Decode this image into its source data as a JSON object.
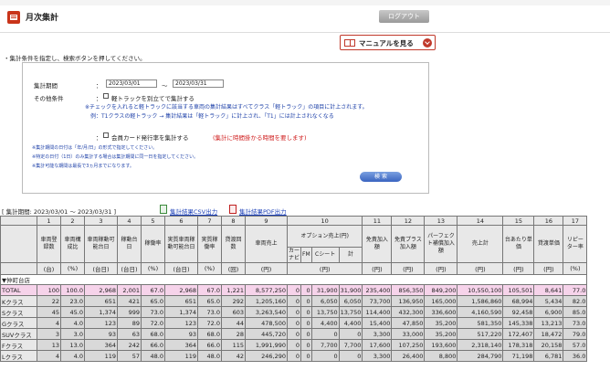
{
  "header": {
    "title": "月次集計",
    "logout_label": "ログアウト"
  },
  "manual_label": "マニュアルを見る",
  "instruction": "・集計条件を指定し、検索ボタンを押してください。",
  "form": {
    "period_label": "集計期間",
    "colon": "：",
    "date_from": "2023/03/01",
    "tilde": "〜",
    "date_to": "2023/03/31",
    "other_label": "その他条件",
    "light_truck_label": "軽トラックを別立てで集計する",
    "light_truck_note1": "※チェックを入れると軽トラックに該当する車両の集計結果はすべてクラス「軽トラック」の項目に計上されます。",
    "light_truck_note2": "例：T1クラスの軽トラック → 集計結果は「軽トラック」に計上され、「T1」には計上されなくなる",
    "card_label": "会員カード発行率を集計する",
    "card_warning": "(集計に時間掛かる時間を要します)",
    "note_a": "※集計期間の日付は「年/月/日」の形式で指定してください。",
    "note_b": "※特定の日付（1日）のみ集計する場合は集計期間に同一日を指定してください。",
    "note_c": "※集計可能な期間は最長で3ヵ月までになります。",
    "search_label": "検 索"
  },
  "result": {
    "period_text": "[ 集計期間: 2023/03/01 〜 2023/03/31 ]",
    "csv_label": "集計結果CSV出力",
    "pdf_label": "集計結果PDF出力"
  },
  "table": {
    "col_numbers": [
      "1",
      "2",
      "3",
      "4",
      "5",
      "6",
      "7",
      "8",
      "9",
      "10",
      "11",
      "12",
      "13",
      "14",
      "15",
      "16",
      "17"
    ],
    "headers": {
      "h1": "車両登録数",
      "h2": "車両構成比",
      "h3": "車両稼動可能台日",
      "h4": "稼動台日",
      "h5": "稼働率",
      "h6": "実質車両稼動可能台日",
      "h7": "実質稼働率",
      "h8": "貸渡回数",
      "h9": "車両売上",
      "h10": "オプション売上(円)",
      "h10a": "カーナビ",
      "h10b": "FM",
      "h10c": "Cシート",
      "h10d": "計",
      "h11": "免責加入額",
      "h12": "免責プラス加入額",
      "h13": "パーフェクト補償加入額",
      "h14": "売上計",
      "h15": "台あたり単価",
      "h16": "貸渡単価",
      "h17": "リピーター率"
    },
    "units": [
      "(台)",
      "(%)",
      "(台日)",
      "(台日)",
      "(%)",
      "(台日)",
      "(%)",
      "(回)",
      "(円)",
      "(円)",
      "(円)",
      "(円)",
      "(円)",
      "(円)",
      "(円)",
      "(%)"
    ],
    "group": "▼仲町台店",
    "rows": [
      {
        "name": "TOTAL",
        "cells": [
          "100",
          "100.0",
          "2,968",
          "2,001",
          "67.0",
          "2,968",
          "67.0",
          "1,221",
          "8,577,250",
          "0",
          "0",
          "31,900",
          "31,900",
          "235,400",
          "856,350",
          "849,200",
          "10,550,100",
          "105,501",
          "8,641",
          "77.0"
        ]
      },
      {
        "name": "Kクラス",
        "cells": [
          "22",
          "23.0",
          "651",
          "421",
          "65.0",
          "651",
          "65.0",
          "292",
          "1,205,160",
          "0",
          "0",
          "6,050",
          "6,050",
          "73,700",
          "136,950",
          "165,000",
          "1,586,860",
          "68,994",
          "5,434",
          "82.0"
        ]
      },
      {
        "name": "Sクラス",
        "cells": [
          "45",
          "45.0",
          "1,374",
          "999",
          "73.0",
          "1,374",
          "73.0",
          "603",
          "3,263,540",
          "0",
          "0",
          "13,750",
          "13,750",
          "114,400",
          "432,300",
          "336,600",
          "4,160,590",
          "92,458",
          "6,900",
          "85.0"
        ]
      },
      {
        "name": "Gクラス",
        "cells": [
          "4",
          "4.0",
          "123",
          "89",
          "72.0",
          "123",
          "72.0",
          "44",
          "478,500",
          "0",
          "0",
          "4,400",
          "4,400",
          "15,400",
          "47,850",
          "35,200",
          "581,350",
          "145,338",
          "13,213",
          "73.0"
        ]
      },
      {
        "name": "SUVクラス",
        "cells": [
          "3",
          "3.0",
          "93",
          "63",
          "68.0",
          "93",
          "68.0",
          "28",
          "445,720",
          "0",
          "0",
          "0",
          "0",
          "3,300",
          "33,000",
          "35,200",
          "517,220",
          "172,407",
          "18,472",
          "79.0"
        ]
      },
      {
        "name": "Fクラス",
        "cells": [
          "13",
          "13.0",
          "364",
          "242",
          "66.0",
          "364",
          "66.0",
          "115",
          "1,991,990",
          "0",
          "0",
          "7,700",
          "7,700",
          "17,600",
          "107,250",
          "193,600",
          "2,318,140",
          "178,318",
          "20,158",
          "57.0"
        ]
      },
      {
        "name": "Lクラス",
        "cells": [
          "4",
          "4.0",
          "119",
          "57",
          "48.0",
          "119",
          "48.0",
          "42",
          "246,290",
          "0",
          "0",
          "0",
          "0",
          "3,300",
          "26,400",
          "8,800",
          "284,790",
          "71,198",
          "6,781",
          "36.0"
        ]
      }
    ]
  }
}
